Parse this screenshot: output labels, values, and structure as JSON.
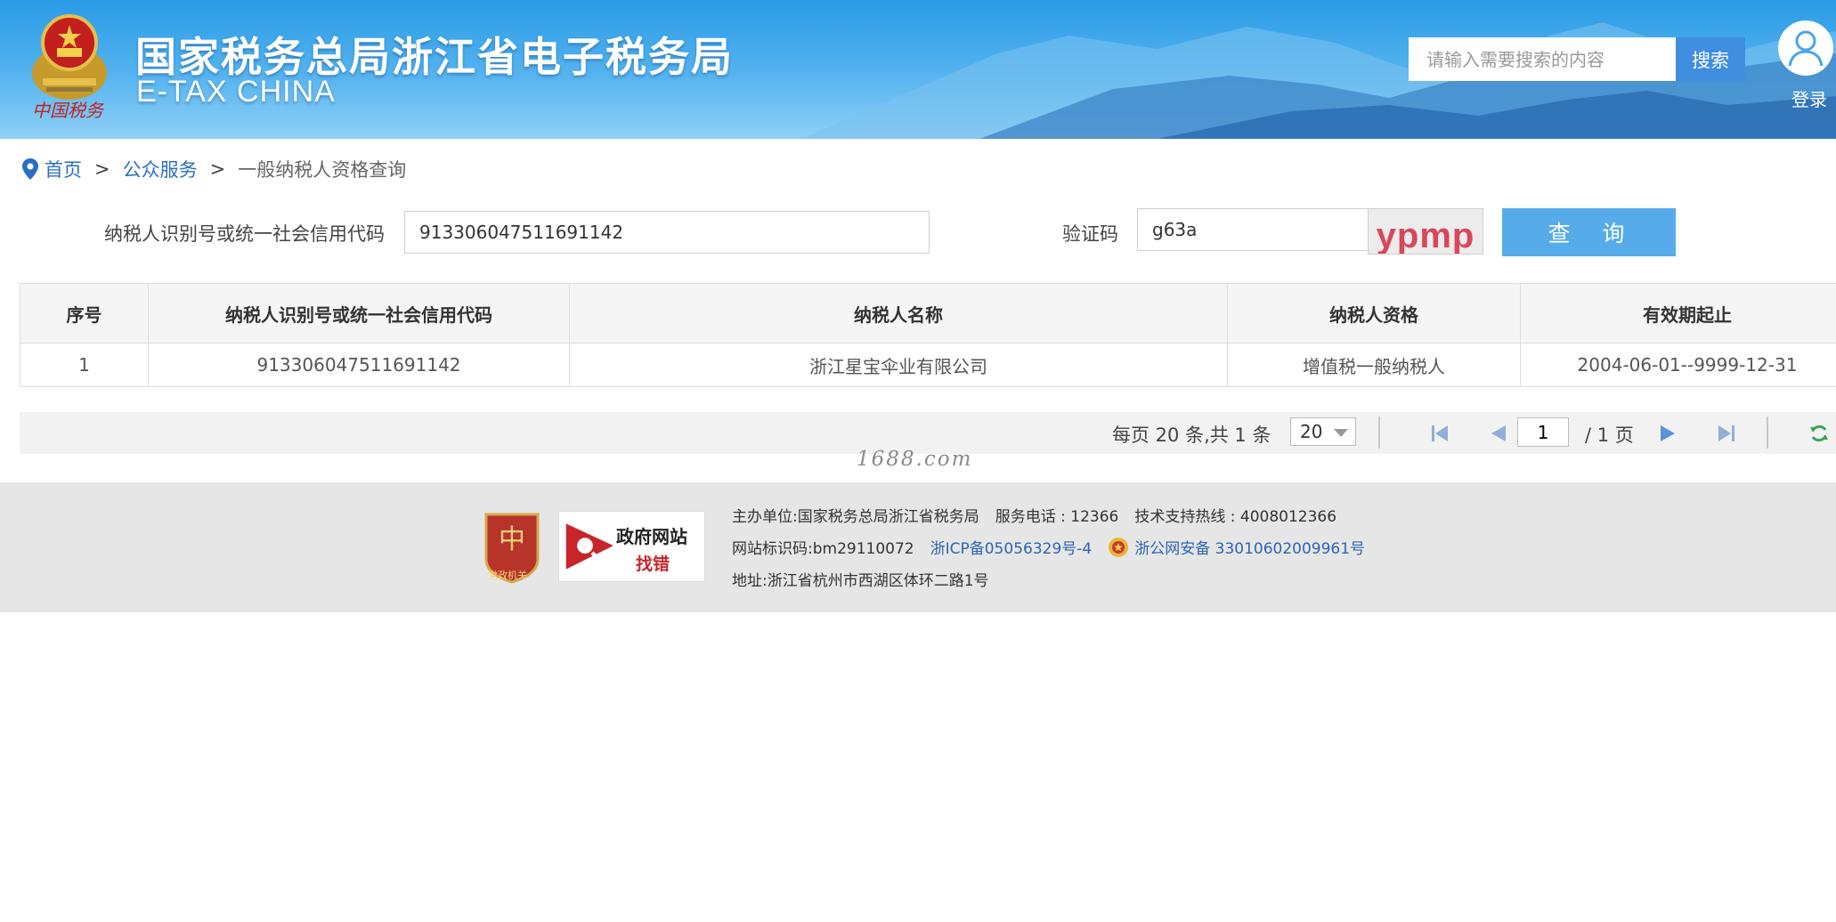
{
  "header": {
    "site_title": "国家税务总局浙江省电子税务局",
    "site_subtitle": "E-TAX CHINA",
    "emblem_caption": "中国税务",
    "search_placeholder": "请输入需要搜索的内容",
    "search_button": "搜索",
    "login_label": "登录"
  },
  "breadcrumb": {
    "home": "首页",
    "sep1": ">",
    "section": "公众服务",
    "sep2": ">",
    "current": "一般纳税人资格查询"
  },
  "query_form": {
    "taxpayer_id_label": "纳税人识别号或统一社会信用代码",
    "taxpayer_id_value": "913306047511691142",
    "captcha_label": "验证码",
    "captcha_value": "g63a",
    "captcha_image_text": "ypmp",
    "submit_button": "查 询"
  },
  "results_table": {
    "headers": [
      "序号",
      "纳税人识别号或统一社会信用代码",
      "纳税人名称",
      "纳税人资格",
      "有效期起止"
    ],
    "rows": [
      [
        "1",
        "913306047511691142",
        "浙江星宝伞业有限公司",
        "增值税一般纳税人",
        "2004-06-01--9999-12-31"
      ]
    ]
  },
  "pagination": {
    "summary": "每页 20 条,共 1 条",
    "page_size": "20",
    "current_page": "1",
    "total_pages": "/ 1 页"
  },
  "watermark": "1688.com",
  "footer": {
    "party_badge_text": "党政机关",
    "gov_badge_title": "政府网站",
    "gov_badge_action": "找错",
    "sponsor_label": "主办单位:",
    "sponsor_value": "国家税务总局浙江省税务局",
    "service_phone": "服务电话 : 12366",
    "support_hotline": "技术支持热线 : 4008012366",
    "site_id": "网站标识码:bm29110072",
    "icp": "浙ICP备05056329号-4",
    "police_record": "浙公网安备 33010602009961号",
    "address": "地址:浙江省杭州市西湖区体环二路1号"
  },
  "colors": {
    "header_blue": "#2a9be6",
    "link_blue": "#2a6fc1",
    "query_button": "#56abeb",
    "captcha_text": "#d8475a",
    "footer_bg": "#e6e6e6"
  }
}
